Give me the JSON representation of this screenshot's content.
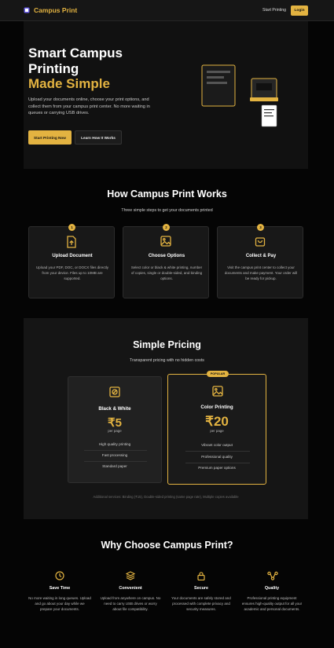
{
  "nav": {
    "brand": "Campus Print",
    "start_link": "Start Printing",
    "login": "Login"
  },
  "hero": {
    "title_lines": [
      "Smart Campus",
      "Printing",
      "Made Simple"
    ],
    "description": "Upload your documents online, choose your print options, and collect them from your campus print center. No more waiting in queues or carrying USB drives.",
    "primary_button": "Start Printing Now",
    "secondary_button": "Learn How It Works"
  },
  "how": {
    "title": "How Campus Print Works",
    "subtitle": "Three simple steps to get your documents printed",
    "steps": [
      {
        "num": "1",
        "icon": "document-upload-icon",
        "title": "Upload Document",
        "desc": "Upload your PDF, DOC, or DOCX files directly from your device. Files up to 10MB are supported."
      },
      {
        "num": "2",
        "icon": "image-options-icon",
        "title": "Choose Options",
        "desc": "Select color or black & white printing, number of copies, single or double-sided, and binding options."
      },
      {
        "num": "3",
        "icon": "shopping-bag-icon",
        "title": "Collect & Pay",
        "desc": "Visit the campus print center to collect your documents and make payment. Your order will be ready for pickup."
      }
    ]
  },
  "pricing": {
    "title": "Simple Pricing",
    "subtitle": "Transparent pricing with no hidden costs",
    "plans": [
      {
        "name": "Black & White",
        "price": "₹5",
        "unit": "per page",
        "features": [
          "High quality printing",
          "Fast processing",
          "Standard paper"
        ]
      },
      {
        "name": "Color Printing",
        "price": "₹20",
        "unit": "per page",
        "badge": "POPULAR",
        "features": [
          "Vibrant color output",
          "Professional quality",
          "Premium paper options"
        ]
      }
    ],
    "note": "Additional services: Binding (₹15), Double-sided printing (same page rate), Multiple copies available"
  },
  "why": {
    "title": "Why Choose Campus Print?",
    "items": [
      {
        "icon": "clock-icon",
        "title": "Save Time",
        "desc": "No more waiting in long queues. Upload and go about your day while we prepare your documents."
      },
      {
        "icon": "layers-icon",
        "title": "Convenient",
        "desc": "Upload from anywhere on campus. No need to carry USB drives or worry about file compatibility."
      },
      {
        "icon": "lock-icon",
        "title": "Secure",
        "desc": "Your documents are safely stored and processed with complete privacy and security measures."
      },
      {
        "icon": "quality-nodes-icon",
        "title": "Quality",
        "desc": "Professional printing equipment ensures high-quality output for all your academic and personal documents."
      }
    ]
  },
  "colors": {
    "accent": "#e3b341",
    "background": "#050505",
    "card": "#181818"
  }
}
